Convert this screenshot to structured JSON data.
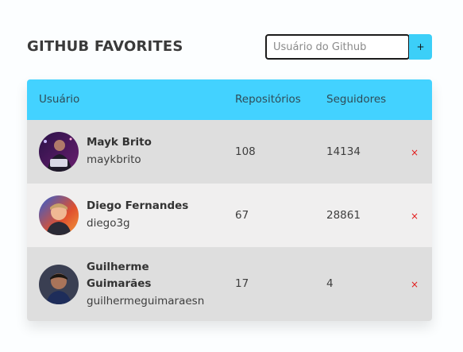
{
  "app": {
    "title": "GITHUB FAVORITES"
  },
  "search": {
    "placeholder": "Usuário do Github",
    "value": "",
    "add_label": "+"
  },
  "table": {
    "headers": {
      "user": "Usuário",
      "repos": "Repositórios",
      "followers": "Seguidores"
    },
    "rows": [
      {
        "name": "Mayk Brito",
        "login": "maykbrito",
        "repos": "108",
        "followers": "14134",
        "remove_label": "×"
      },
      {
        "name": "Diego Fernandes",
        "login": "diego3g",
        "repos": "67",
        "followers": "28861",
        "remove_label": "×"
      },
      {
        "name_line1": "Guilherme",
        "name_line2": "Guimarães",
        "login": "guilhermeguimaraesn",
        "repos": "17",
        "followers": "4",
        "remove_label": "×"
      }
    ]
  },
  "colors": {
    "accent": "#43d2ff",
    "button": "#3ccff8",
    "row_dark": "#dedede",
    "row_light": "#f0efef",
    "remove": "#e21b1b"
  }
}
